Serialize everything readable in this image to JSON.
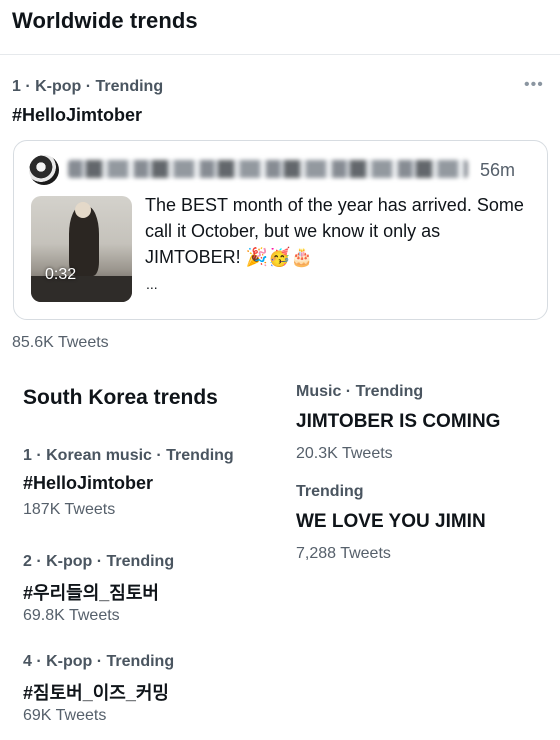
{
  "worldwide": {
    "title": "Worldwide trends",
    "trend1": {
      "meta": "1 · K-pop · Trending",
      "tag": "#HelloJimtober",
      "more_icon": "more-dots-icon",
      "tweet": {
        "time": "56m",
        "text": "The BEST month of the year has arrived. Some call it October, but we know it only as JIMTOBER! 🎉🥳🎂",
        "ellipsis": "...",
        "video_duration": "0:32"
      },
      "count": "85.6K Tweets"
    }
  },
  "south_korea": {
    "title": "South Korea trends",
    "items": [
      {
        "meta": "1 · Korean music · Trending",
        "tag": "#HelloJimtober",
        "count": "187K Tweets"
      },
      {
        "meta": "2 · K-pop · Trending",
        "tag": "#우리들의_짐토버",
        "count": "69.8K Tweets"
      },
      {
        "meta": "4 · K-pop · Trending",
        "tag": "#짐토버_이즈_커밍",
        "count": "69K Tweets"
      }
    ]
  },
  "right_trends": [
    {
      "meta": "Music · Trending",
      "tag": "JIMTOBER IS COMING",
      "count": "20.3K Tweets"
    },
    {
      "meta": "Trending",
      "tag": "WE LOVE YOU JIMIN",
      "count": "7,288 Tweets"
    }
  ]
}
